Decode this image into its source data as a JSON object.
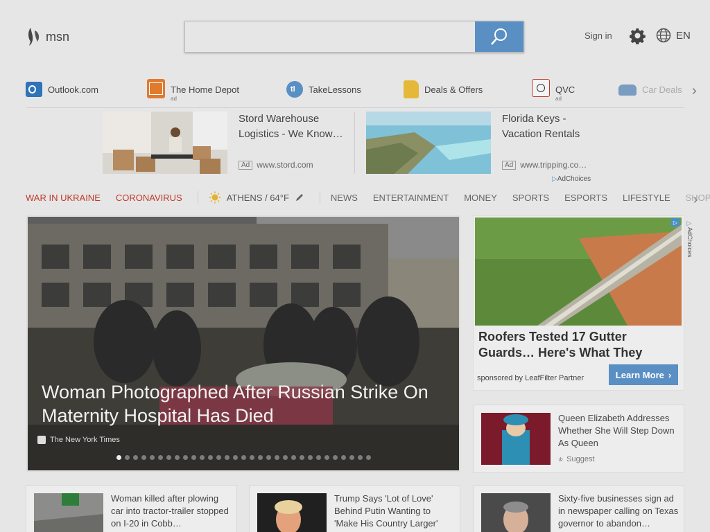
{
  "header": {
    "logo_text": "msn",
    "search_placeholder": "",
    "signin_label": "Sign in",
    "language": "EN"
  },
  "quicklinks": [
    {
      "label": "Outlook.com",
      "ad": ""
    },
    {
      "label": "The Home Depot",
      "ad": "ad"
    },
    {
      "label": "TakeLessons",
      "ad": ""
    },
    {
      "label": "Deals & Offers",
      "ad": ""
    },
    {
      "label": "QVC",
      "ad": "ad"
    },
    {
      "label": "Car Deals",
      "ad": ""
    }
  ],
  "ads": [
    {
      "title": "Stord Warehouse Logistics - We Know…",
      "badge": "Ad",
      "url": "www.stord.com"
    },
    {
      "title": "Florida Keys - Vacation Rentals",
      "badge": "Ad",
      "url": "www.tripping.co…"
    }
  ],
  "adchoices_label": "AdChoices",
  "nav": {
    "war": "WAR IN UKRAINE",
    "corona": "CORONAVIRUS",
    "weather": "ATHENS / 64°F",
    "items": [
      "NEWS",
      "ENTERTAINMENT",
      "MONEY",
      "SPORTS",
      "ESPORTS",
      "LIFESTYLE",
      "SHOPPING"
    ]
  },
  "hero": {
    "title": "Woman Photographed After Russian Strike On Maternity Hospital Has Died",
    "source": "The New York Times",
    "slide_count": 31,
    "active_slide": 1
  },
  "sidead": {
    "title": "Roofers Tested 17 Gutter Guards… Here's What They",
    "sponsor": "sponsored by LeafFilter Partner",
    "cta": "Learn More",
    "choice": "AdChoices"
  },
  "cards": [
    {
      "title": "Queen Elizabeth Addresses Whether She Will Step Down As Queen",
      "source": "Suggest"
    },
    {
      "title": "Woman killed after plowing car into tractor-trailer stopped on I-20 in Cobb…",
      "source": ""
    },
    {
      "title": "Trump Says 'Lot of Love' Behind Putin Wanting to 'Make His Country Larger'",
      "source": ""
    },
    {
      "title": "Sixty-five businesses sign ad in newspaper calling on Texas governor to abandon…",
      "source": ""
    }
  ],
  "colors": {
    "accent": "#5a8fc4",
    "hot": "#c0392b",
    "background": "#e6e6e6"
  }
}
